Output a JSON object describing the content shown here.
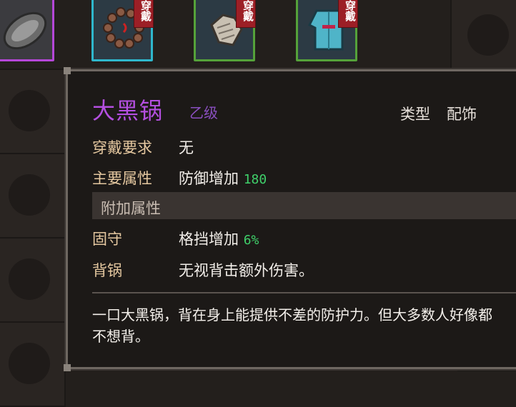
{
  "slots": [
    {
      "name": "wok",
      "badge": ""
    },
    {
      "name": "prayer-beads",
      "badge": "穿戴"
    },
    {
      "name": "gloves",
      "badge": "穿戴"
    },
    {
      "name": "robe",
      "badge": "穿戴"
    }
  ],
  "item": {
    "name": "大黑锅",
    "grade": "乙级",
    "type_label": "类型",
    "type_value": "配饰",
    "requirement_label": "穿戴要求",
    "requirement_value": "无",
    "main_attr_label": "主要属性",
    "main_attr_text": "防御增加",
    "main_attr_value": "180",
    "extra_section_title": "附加属性",
    "extra_attrs": [
      {
        "label": "固守",
        "text": "格挡增加",
        "value": "6%"
      },
      {
        "label": "背锅",
        "text": "无视背击额外伤害。",
        "value": ""
      }
    ],
    "description": "一口大黑锅，背在身上能提供不差的防护力。但大多数人好像都不想背。"
  },
  "colors": {
    "item_name": "#b44fe0",
    "stat_number": "#3fd06a",
    "label": "#e5c8a0"
  }
}
